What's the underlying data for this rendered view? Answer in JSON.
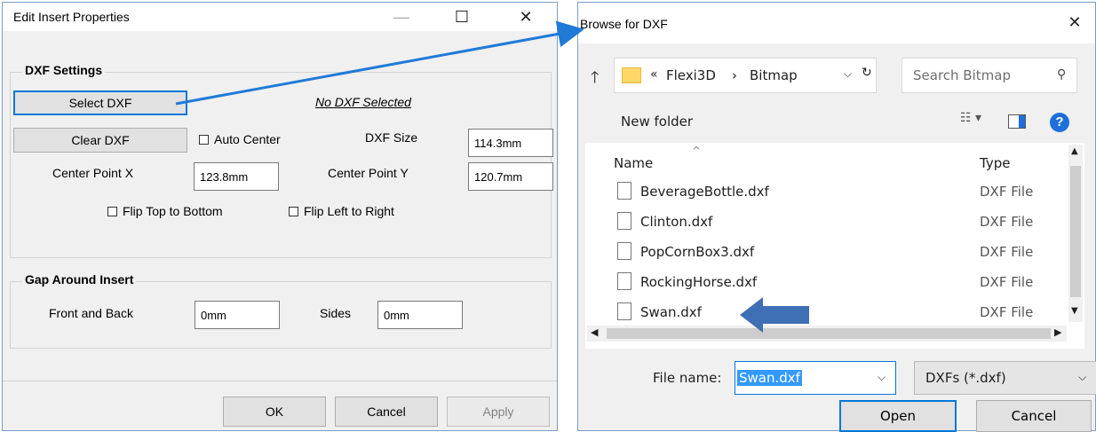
{
  "left_dialog": {
    "title": "Edit Insert Properties",
    "controls": {
      "minimize": "—",
      "maximize": "☐",
      "close": "✕"
    },
    "dxf_settings": {
      "group_label": "DXF Settings",
      "select_button": "Select DXF",
      "status_text": "No DXF Selected",
      "clear_button": "Clear DXF",
      "auto_center_label": "Auto Center",
      "dxf_size_label": "DXF Size",
      "dxf_size_value": "114.3mm",
      "center_x_label": "Center Point X",
      "center_x_value": "123.8mm",
      "center_y_label": "Center Point Y",
      "center_y_value": "120.7mm",
      "flip_top_bottom_label": "Flip Top to Bottom",
      "flip_left_right_label": "Flip Left to Right"
    },
    "gap": {
      "group_label": "Gap Around Insert",
      "front_back_label": "Front and Back",
      "front_back_value": "0mm",
      "sides_label": "Sides",
      "sides_value": "0mm"
    },
    "buttons": {
      "ok": "OK",
      "cancel": "Cancel",
      "apply": "Apply"
    }
  },
  "right_dialog": {
    "title": "Browse for DXF",
    "close": "✕",
    "breadcrumb": {
      "prefix": "«",
      "items": [
        "Flexi3D",
        "Bitmap"
      ],
      "separator": "›"
    },
    "search_placeholder": "Search Bitmap",
    "new_folder": "New folder",
    "columns": {
      "name": "Name",
      "type": "Type"
    },
    "files": [
      {
        "name": "BeverageBottle.dxf",
        "type": "DXF File"
      },
      {
        "name": "Clinton.dxf",
        "type": "DXF File"
      },
      {
        "name": "PopCornBox3.dxf",
        "type": "DXF File"
      },
      {
        "name": "RockingHorse.dxf",
        "type": "DXF File"
      },
      {
        "name": "Swan.dxf",
        "type": "DXF File"
      }
    ],
    "file_name_label": "File name:",
    "file_name_value": "Swan.dxf",
    "filter_value": "DXFs (*.dxf)",
    "open_button": "Open",
    "cancel_button": "Cancel"
  },
  "colors": {
    "accent": "#0078d7",
    "arrow": "#1f7ad8",
    "swan_arrow": "#3f6fb4",
    "selection": "#3399ff"
  }
}
